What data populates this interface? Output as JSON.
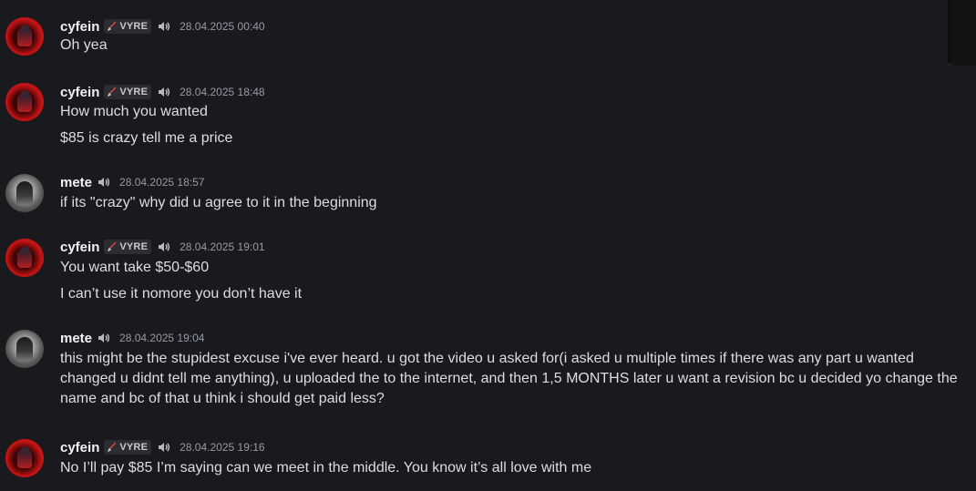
{
  "colors": {
    "background": "#1a1a1e",
    "username": "#f2f3f5",
    "message_text": "#dbdee1",
    "timestamp": "#949ba4",
    "tag_bg": "#2c2d32"
  },
  "messages": [
    {
      "user": "cyfein",
      "avatar": "red-avatar",
      "tag": "VYRE",
      "timestamp": "28.04.2025 00:40",
      "lines": [
        "Oh yea"
      ]
    },
    {
      "user": "cyfein",
      "avatar": "red-avatar",
      "tag": "VYRE",
      "timestamp": "28.04.2025 18:48",
      "lines": [
        "How much you wanted",
        "$85 is crazy tell me a price"
      ]
    },
    {
      "user": "mete",
      "avatar": "gray-avatar",
      "tag": "",
      "timestamp": "28.04.2025 18:57",
      "lines": [
        "if its \"crazy\" why did u agree to it in the beginning"
      ]
    },
    {
      "user": "cyfein",
      "avatar": "red-avatar",
      "tag": "VYRE",
      "timestamp": "28.04.2025 19:01",
      "lines": [
        "You want take $50-$60",
        "I can’t use it nomore you don’t have it"
      ]
    },
    {
      "user": "mete",
      "avatar": "gray-avatar",
      "tag": "",
      "timestamp": "28.04.2025 19:04",
      "lines": [
        "this might be the stupidest excuse i've ever heard. u got the video u asked for(i asked u multiple times if there was any part u wanted changed u didnt tell me anything), u uploaded the to the internet, and then 1,5 MONTHS later u want a revision bc u decided yo change the name and bc of that u think i should get paid less?"
      ]
    },
    {
      "user": "cyfein",
      "avatar": "red-avatar",
      "tag": "VYRE",
      "timestamp": "28.04.2025 19:16",
      "lines": [
        "No I’ll pay $85 I’m saying can we meet in the middle. You know it’s all love with me"
      ]
    }
  ]
}
